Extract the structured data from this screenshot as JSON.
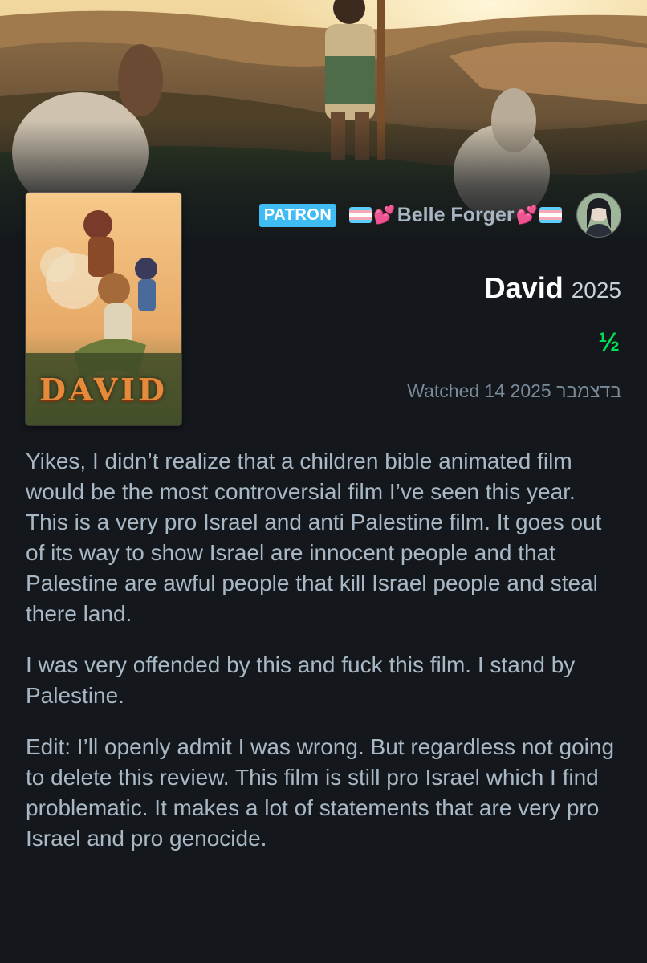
{
  "user": {
    "badge": "PATRON",
    "username": "Belle Forger",
    "hearts": "💕"
  },
  "film": {
    "title": "David",
    "year": "2025",
    "poster_title": "DAVID",
    "rating": "½",
    "watched": "Watched 14 בדצמבר 2025"
  },
  "review": {
    "paragraphs": [
      "Yikes, I didn’t realize that a children bible animated film would be the most controversial film I’ve seen this year. This is a very pro Israel and anti Palestine film. It goes out of its way to show Israel are innocent people and that Palestine are awful people that kill Israel people and steal there land.",
      "I was very offended by this and fuck this film. I stand by Palestine.",
      "Edit: I’ll openly admit I was wrong. But regardless not going to delete this review. This film is still pro Israel which I find problematic. It makes a lot of statements that are very pro Israel and pro genocide."
    ]
  },
  "colors": {
    "background": "#14181c",
    "patron_badge": "#40bcf4",
    "rating": "#00e054",
    "review_text": "#a9b8c5",
    "muted_text": "#7a8a99"
  },
  "icons": {
    "flag": "trans-flag-icon",
    "hearts": "two-hearts-icon"
  }
}
